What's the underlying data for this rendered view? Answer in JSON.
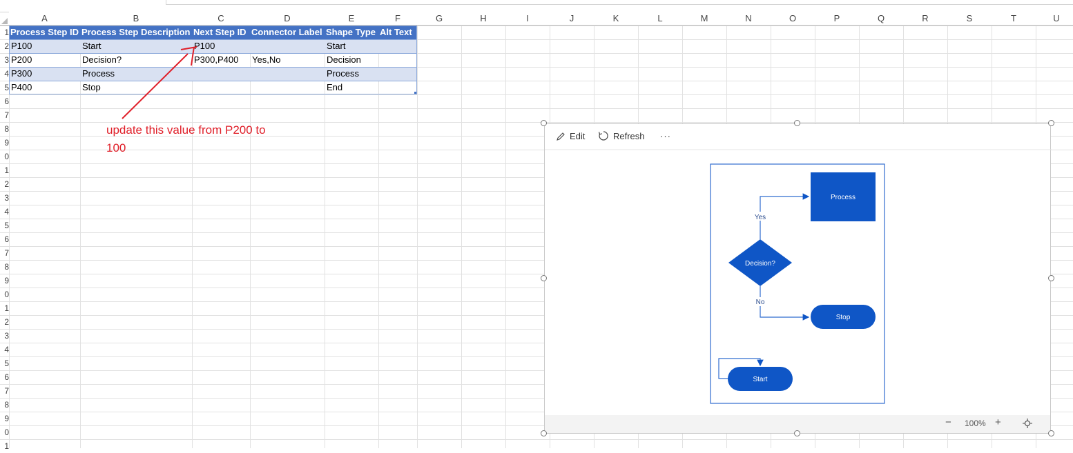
{
  "columns": [
    "A",
    "B",
    "C",
    "D",
    "E",
    "F",
    "G",
    "H",
    "I",
    "J",
    "K",
    "L",
    "M",
    "N",
    "O",
    "P",
    "Q",
    "R",
    "S",
    "T",
    "U"
  ],
  "rows": [
    "1",
    "2",
    "3",
    "4",
    "5",
    "6",
    "7",
    "8",
    "9",
    "0",
    "1",
    "2",
    "3",
    "4",
    "5",
    "6",
    "7",
    "8",
    "9",
    "0",
    "1",
    "2",
    "3",
    "4",
    "5",
    "6",
    "7",
    "8",
    "9",
    "0",
    "1"
  ],
  "table": {
    "headers": [
      "Process Step ID",
      "Process Step Description",
      "Next Step ID",
      "Connector Label",
      "Shape Type",
      "Alt Text"
    ],
    "rows": [
      [
        "P100",
        "Start",
        "P100",
        "",
        "Start",
        ""
      ],
      [
        "P200",
        "Decision?",
        "P300,P400",
        "Yes,No",
        "Decision",
        ""
      ],
      [
        "P300",
        "Process",
        "",
        "",
        "Process",
        ""
      ],
      [
        "P400",
        "Stop",
        "",
        "",
        "End",
        ""
      ]
    ]
  },
  "annotation": {
    "line1": "update this value from P200 to",
    "line2": "100"
  },
  "diagram": {
    "toolbar": {
      "edit": "Edit",
      "refresh": "Refresh",
      "more": "···"
    },
    "shapes": {
      "process": "Process",
      "decision": "Decision?",
      "stop": "Stop",
      "start": "Start"
    },
    "connectors": {
      "yes": "Yes",
      "no": "No"
    },
    "zoom": "100%",
    "zoom_minus": "−",
    "zoom_plus": "+"
  },
  "colors": {
    "accent": "#0f56c6",
    "table_header": "#4472c4",
    "band": "#d9e1f2",
    "annotation": "#e0202a"
  }
}
